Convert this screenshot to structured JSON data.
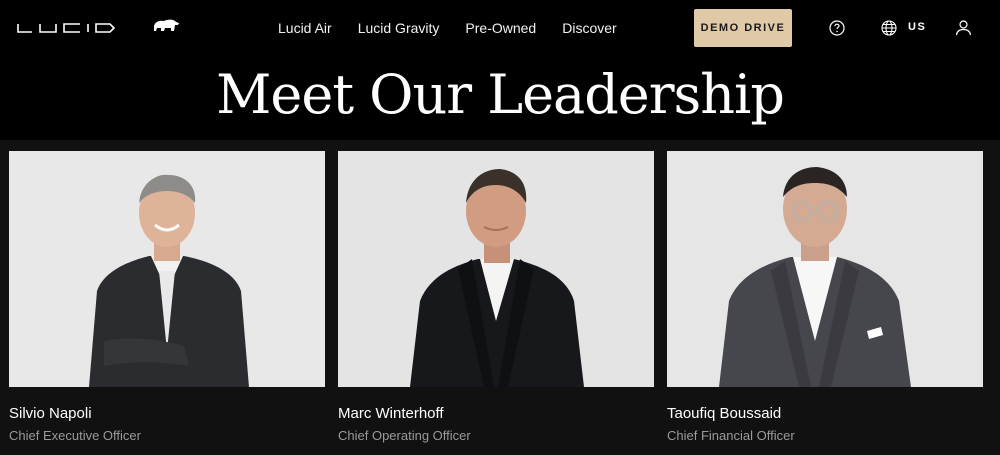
{
  "header": {
    "brand": "LUCID",
    "nav": [
      "Lucid Air",
      "Lucid Gravity",
      "Pre-Owned",
      "Discover"
    ],
    "cta_label": "DEMO DRIVE",
    "region": "US",
    "icons": [
      "bear-icon",
      "help-icon",
      "globe-icon",
      "user-icon"
    ]
  },
  "hero": {
    "title": "Meet Our Leadership"
  },
  "leaders": [
    {
      "name": "Silvio Napoli",
      "role": "Chief Executive Officer"
    },
    {
      "name": "Marc Winterhoff",
      "role": "Chief Operating Officer"
    },
    {
      "name": "Taoufiq Boussaid",
      "role": "Chief Financial Officer"
    }
  ],
  "colors": {
    "background": "#111111",
    "header": "#000000",
    "cta": "#e0c9a6",
    "role_text": "#9a9a9a"
  }
}
